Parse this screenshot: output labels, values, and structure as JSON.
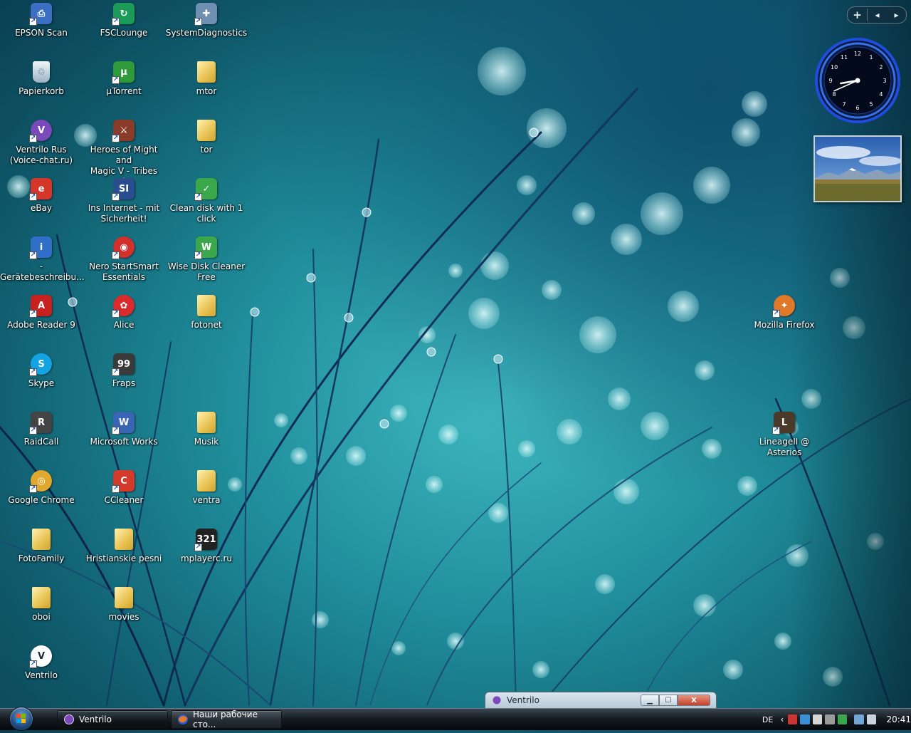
{
  "desktop": {
    "icons": [
      {
        "label": "EPSON Scan",
        "icon": "scanner-icon",
        "color": "#3a6fc4"
      },
      {
        "label": "FSCLounge",
        "icon": "fsc-lounge-icon",
        "color": "#1c9a57"
      },
      {
        "label": "SystemDiagnostics",
        "icon": "diagnostics-icon",
        "color": "#6f8fb3"
      },
      {
        "label": "Papierkorb",
        "icon": "recycle-bin-icon",
        "color": "#9ab3c6"
      },
      {
        "label": "µTorrent",
        "icon": "utorrent-icon",
        "color": "#2f9a3a"
      },
      {
        "label": "mtor",
        "icon": "folder-icon",
        "color": "#e8c251"
      },
      {
        "label": "Ventrilo Rus\n(Voice-chat.ru)",
        "icon": "ventrilo-icon",
        "color": "#7a4bb8"
      },
      {
        "label": "Heroes of Might and\nMagic V - Tribes of...",
        "icon": "heroes-game-icon",
        "color": "#8a3b2a"
      },
      {
        "label": "tor",
        "icon": "folder-icon",
        "color": "#e8c251"
      },
      {
        "label": "eBay",
        "icon": "ebay-icon",
        "color": "#d6352a"
      },
      {
        "label": "Ins Internet - mit\nSicherheit!",
        "icon": "internet-security-icon",
        "color": "#2a4d8f"
      },
      {
        "label": "Clean disk with 1\nclick",
        "icon": "clean-disk-icon",
        "color": "#3aa84a"
      },
      {
        "label": "-\nGerätebeschreibu...",
        "icon": "info-icon",
        "color": "#2f6fc8"
      },
      {
        "label": "Nero StartSmart\nEssentials",
        "icon": "nero-icon",
        "color": "#d2302b"
      },
      {
        "label": "Wise Disk Cleaner\nFree",
        "icon": "wise-disk-cleaner-icon",
        "color": "#3aa84a"
      },
      {
        "label": "Adobe Reader 9",
        "icon": "adobe-reader-icon",
        "color": "#c8201e"
      },
      {
        "label": "Alice",
        "icon": "alice-icon",
        "color": "#d92b2b"
      },
      {
        "label": "fotonet",
        "icon": "folder-icon",
        "color": "#e8c251"
      },
      {
        "label": "Skype",
        "icon": "skype-icon",
        "color": "#13a3e3"
      },
      {
        "label": "Fraps",
        "icon": "fraps-icon",
        "color": "#3a3a3a"
      },
      {
        "label": "RaidCall",
        "icon": "raidcall-icon",
        "color": "#444444"
      },
      {
        "label": "Microsoft Works",
        "icon": "microsoft-works-icon",
        "color": "#3a65b5"
      },
      {
        "label": "Musik",
        "icon": "folder-icon",
        "color": "#e8c251"
      },
      {
        "label": "Google Chrome",
        "icon": "chrome-icon",
        "color": "#e0a82e"
      },
      {
        "label": "CCleaner",
        "icon": "ccleaner-icon",
        "color": "#d33a2a"
      },
      {
        "label": "ventra",
        "icon": "folder-icon",
        "color": "#e8c251"
      },
      {
        "label": "FotoFamily",
        "icon": "folder-icon",
        "color": "#e8c251"
      },
      {
        "label": "Hristianskie pesni",
        "icon": "folder-icon",
        "color": "#e8c251"
      },
      {
        "label": "mplayerc.ru",
        "icon": "media-player-icon",
        "color": "#222222"
      },
      {
        "label": "oboi",
        "icon": "folder-icon",
        "color": "#e8c251"
      },
      {
        "label": "movies",
        "icon": "folder-icon",
        "color": "#e8c251"
      },
      {
        "label": "Ventrilo",
        "icon": "ventrilo-icon",
        "color": "#ffffff"
      },
      {
        "label": "Mozilla Firefox",
        "icon": "firefox-icon",
        "color": "#e0782a"
      },
      {
        "label": "LineageII @ Asterios",
        "icon": "lineage-icon",
        "color": "#4b3a2a"
      }
    ]
  },
  "sidebar": {
    "add_label": "+",
    "prev_label": "◂",
    "next_label": "▸",
    "clock": {
      "hour": 8,
      "minute": 41,
      "numbers": [
        "12",
        "1",
        "2",
        "3",
        "4",
        "5",
        "6",
        "7",
        "8",
        "9",
        "10",
        "11"
      ],
      "ring_color": "#2b6dff"
    }
  },
  "minimized_window": {
    "title": "Ventrilo",
    "minimize_label": "▁",
    "maximize_label": "☐",
    "close_label": "X"
  },
  "taskbar": {
    "buttons": [
      {
        "label": "Ventrilo",
        "icon": "ventrilo-icon",
        "active": true
      },
      {
        "label": "Наши рабочие сто...",
        "icon": "firefox-icon",
        "active": false
      }
    ],
    "tray": {
      "language": "DE",
      "expand_label": "‹",
      "time": "20:41",
      "icons": [
        "network-icon",
        "security-icon",
        "utorrent-tray-icon",
        "ventrilo-tray-icon",
        "update-icon",
        "display-icon",
        "volume-icon"
      ]
    }
  }
}
